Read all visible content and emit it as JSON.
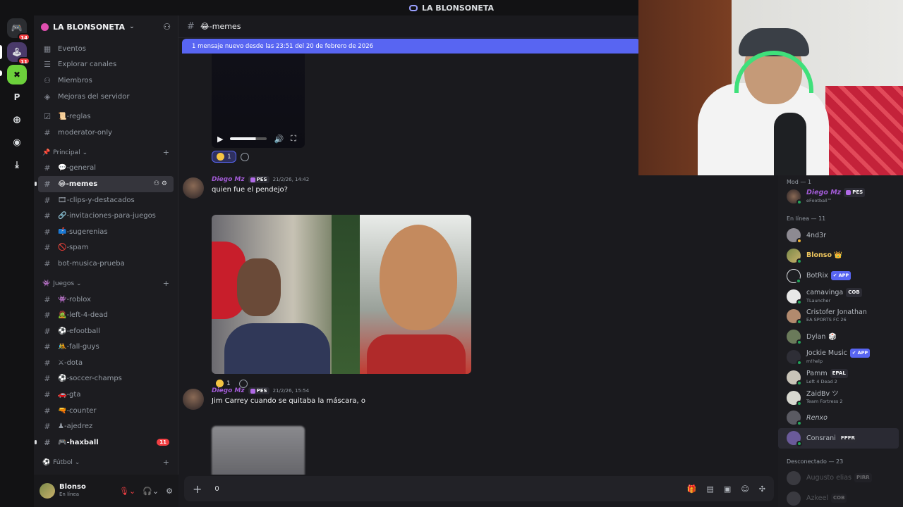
{
  "title_bar": {
    "title": "LA BLONSONETA"
  },
  "rail": {
    "items": [
      {
        "label": "",
        "badge": "14"
      },
      {
        "label": "",
        "badge": "11"
      },
      {
        "label": "",
        "badge": ""
      },
      {
        "label": "P",
        "badge": ""
      }
    ]
  },
  "server": {
    "name": "LA BLONSONETA",
    "menu": [
      "Eventos",
      "Explorar canales",
      "Miembros",
      "Mejoras del servidor"
    ],
    "top_channels": [
      "📜-reglas",
      "moderator-only"
    ],
    "category_principal": "Principal",
    "principal": [
      "💬-general",
      "😂-memes",
      "🎞-clips-y-destacados",
      "🔗-invitaciones-para-juegos",
      "📫-sugerenias",
      "🚫-spam",
      "bot-musica-prueba"
    ],
    "category_juegos": "Juegos",
    "juegos": [
      "👾-roblox",
      "🧟-left-4-dead",
      "⚽-efootball",
      "🤼-fall-guys",
      "⚔-dota",
      "⚽-soccer-champs",
      "🚗-gta",
      "🔫-counter",
      "♟-ajedrez",
      "🎮-haxball"
    ],
    "haxball_badge": "11",
    "category_futbol": "Fútbol"
  },
  "user_panel": {
    "name": "Blonso",
    "status": "En línea"
  },
  "channel": {
    "name": "😂-memes"
  },
  "new_messages_bar": "1 mensaje nuevo desde las 23:51 del 20 de febrero de 2026",
  "reactions": [
    {
      "count": "1"
    },
    {
      "count": "1"
    }
  ],
  "messages": [
    {
      "author": "Diego Mz",
      "tag": "PES",
      "time": "21/2/26, 14:42",
      "text": "quien fue el pendejo?"
    },
    {
      "author": "Diego Mz",
      "tag": "PES",
      "time": "21/2/26, 15:54",
      "text": "Jim Carrey cuando se quitaba la máscara, o"
    }
  ],
  "composer": {
    "value": "0"
  },
  "members": {
    "mod_header": "Mod — 1",
    "mods": [
      {
        "name": "Diego Mz",
        "tag": "PES",
        "activity": "eFootball™"
      }
    ],
    "online_header": "En línea — 11",
    "online": [
      {
        "name": "4nd3r",
        "activity": "",
        "badge": ""
      },
      {
        "name": "Blonso 👑",
        "activity": "",
        "badge": ""
      },
      {
        "name": "BotRix",
        "activity": "",
        "badge": "✔ APP"
      },
      {
        "name": "camavinga",
        "activity": "TLauncher",
        "badge": "COB"
      },
      {
        "name": "Cristofer Jonathan",
        "activity": "EA SPORTS FC 26",
        "badge": ""
      },
      {
        "name": "Dylan",
        "activity": "",
        "badge": ""
      },
      {
        "name": "Jockie Music",
        "activity": "m!help",
        "badge": "✔ APP"
      },
      {
        "name": "Pamm",
        "activity": "Left 4 Dead 2",
        "badge": "EPAL"
      },
      {
        "name": "ZaidBv ツ",
        "activity": "Team Fortress 2",
        "badge": ""
      },
      {
        "name": "Renxo",
        "activity": "",
        "badge": ""
      },
      {
        "name": "Consrani",
        "activity": "",
        "badge": "FPFR"
      }
    ],
    "offline_header": "Desconectado — 23",
    "offline": [
      {
        "name": "Augusto elias",
        "badge": "PIRR"
      },
      {
        "name": "Azkeel",
        "badge": "COB"
      }
    ]
  }
}
